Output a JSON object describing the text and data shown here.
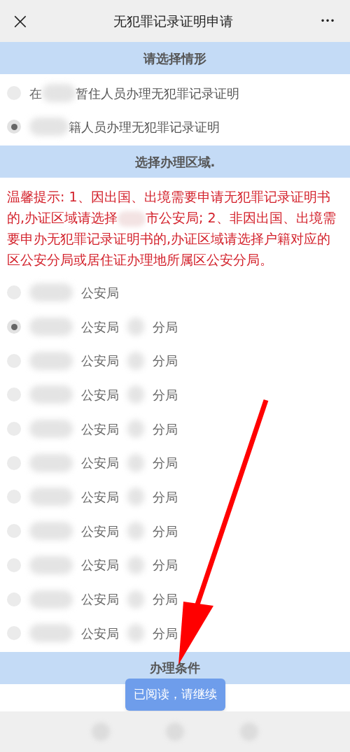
{
  "header": {
    "close": "×",
    "title": "无犯罪记录证明申请",
    "more": "•••"
  },
  "situation": {
    "heading": "请选择情形",
    "options": [
      {
        "before": "在",
        "after": "暂住人员办理无犯罪记录证明",
        "selected": false
      },
      {
        "after": "籍人员办理无犯罪记录证明",
        "selected": true
      }
    ]
  },
  "region": {
    "heading": "选择办理区域.",
    "tip": {
      "before": "温馨提示: 1、因出国、出境需要申请无犯罪记录证明书的,办证区域请选择",
      "after": "市公安局; 2、非因出国、出境需要申办无犯罪记录证明书的,办证区域请选择户籍对应的区公安分局或居住证办理地所属区公安分局。"
    },
    "offices": [
      {
        "before": "公安局",
        "selected": false
      },
      {
        "before": "公安局",
        "after": "分局",
        "selected": true
      },
      {
        "before": "公安局",
        "after": "分局",
        "selected": false
      },
      {
        "before": "公安局",
        "after": "分局",
        "selected": false
      },
      {
        "before": "公安局",
        "after": "分局",
        "selected": false
      },
      {
        "before": "公安局",
        "after": "分局",
        "selected": false
      },
      {
        "before": "公安局",
        "after": "分局",
        "selected": false
      },
      {
        "before": "公安局",
        "after": "分局",
        "selected": false
      },
      {
        "before": "公安局",
        "after": "分局",
        "selected": false
      },
      {
        "before": "公安局",
        "after": "分局",
        "selected": false
      },
      {
        "before": "公安局",
        "after": "分局",
        "selected": false
      }
    ]
  },
  "conditions": {
    "heading": "办理条件"
  },
  "continue_button": "已阅读，请继续"
}
